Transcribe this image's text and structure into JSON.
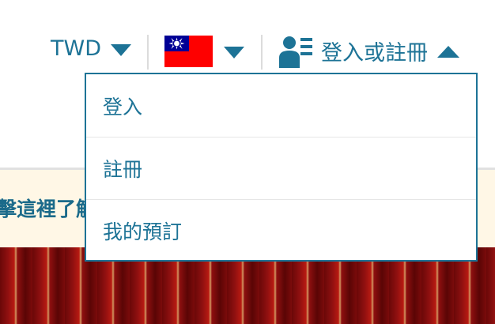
{
  "header": {
    "currency": "TWD",
    "account_label": "登入或註冊"
  },
  "account_menu": {
    "items": [
      {
        "label": "登入"
      },
      {
        "label": "註冊"
      },
      {
        "label": "我的預訂"
      }
    ]
  },
  "notice": {
    "text": "擊這裡了解"
  },
  "colors": {
    "accent": "#1d7396",
    "notice_bg": "#fff7e6",
    "flag_red": "#fe0000",
    "flag_blue": "#000095"
  }
}
